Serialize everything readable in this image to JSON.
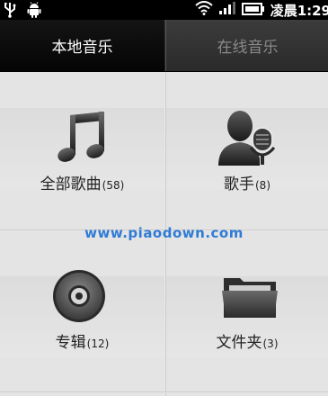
{
  "status_bar": {
    "usb_icon": "usb-icon",
    "android_icon": "android-icon",
    "wifi_icon": "wifi-icon",
    "signal_icon": "signal-icon",
    "battery_icon": "battery-icon",
    "time": "凌晨1:29"
  },
  "tabs": [
    {
      "label": "本地音乐",
      "active": true
    },
    {
      "label": "在线音乐",
      "active": false
    }
  ],
  "grid": {
    "all_songs": {
      "label": "全部歌曲",
      "count": "(58)",
      "icon": "music-note-icon"
    },
    "artists": {
      "label": "歌手",
      "count": "(8)",
      "icon": "singer-microphone-icon"
    },
    "albums": {
      "label": "专辑",
      "count": "(12)",
      "icon": "disc-icon"
    },
    "folders": {
      "label": "文件夹",
      "count": "(3)",
      "icon": "folder-icon"
    }
  },
  "watermark": "www.piaodown.com",
  "colors": {
    "status_bar_bg": "#000000",
    "tab_active_text": "#ffffff",
    "tab_inactive_text": "#8a8a8a",
    "grid_bg": "#e4e4e4",
    "watermark": "#2e7bd6"
  }
}
